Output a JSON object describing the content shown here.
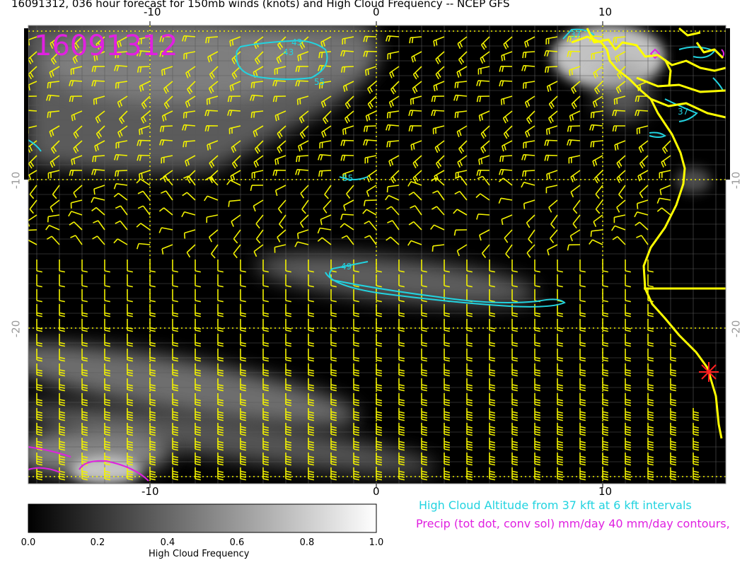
{
  "title": "16091312, 036 hour forecast for 150mb winds (knots) and High Cloud Frequency -- NCEP GFS",
  "stamp": "16091312",
  "axes": {
    "top": [
      "-10",
      "0",
      "10"
    ],
    "bottom": [
      "-10",
      "0",
      "10"
    ],
    "left": [
      "-10",
      "-20"
    ],
    "right": [
      "-10",
      "-20"
    ]
  },
  "contour_labels": [
    "37",
    "43",
    "55",
    "55",
    "37",
    "43",
    "49"
  ],
  "legend": {
    "cloud_altitude": "High Cloud Altitude from 37 kft at 6 kft intervals",
    "precip": "Precip (tot dot, conv sol) mm/day 40 mm/day contours,"
  },
  "colorbar": {
    "title": "High Cloud Frequency",
    "ticks": [
      "0.0",
      "0.2",
      "0.4",
      "0.6",
      "0.8",
      "1.0"
    ]
  },
  "colors": {
    "barbs": "#f2f200",
    "coast": "#ffff00",
    "altitude_contour": "#22d3e0",
    "precip_contour": "#e020e0",
    "stamp": "#e020e0",
    "marker": "#ff2020",
    "background": "#000000"
  }
}
